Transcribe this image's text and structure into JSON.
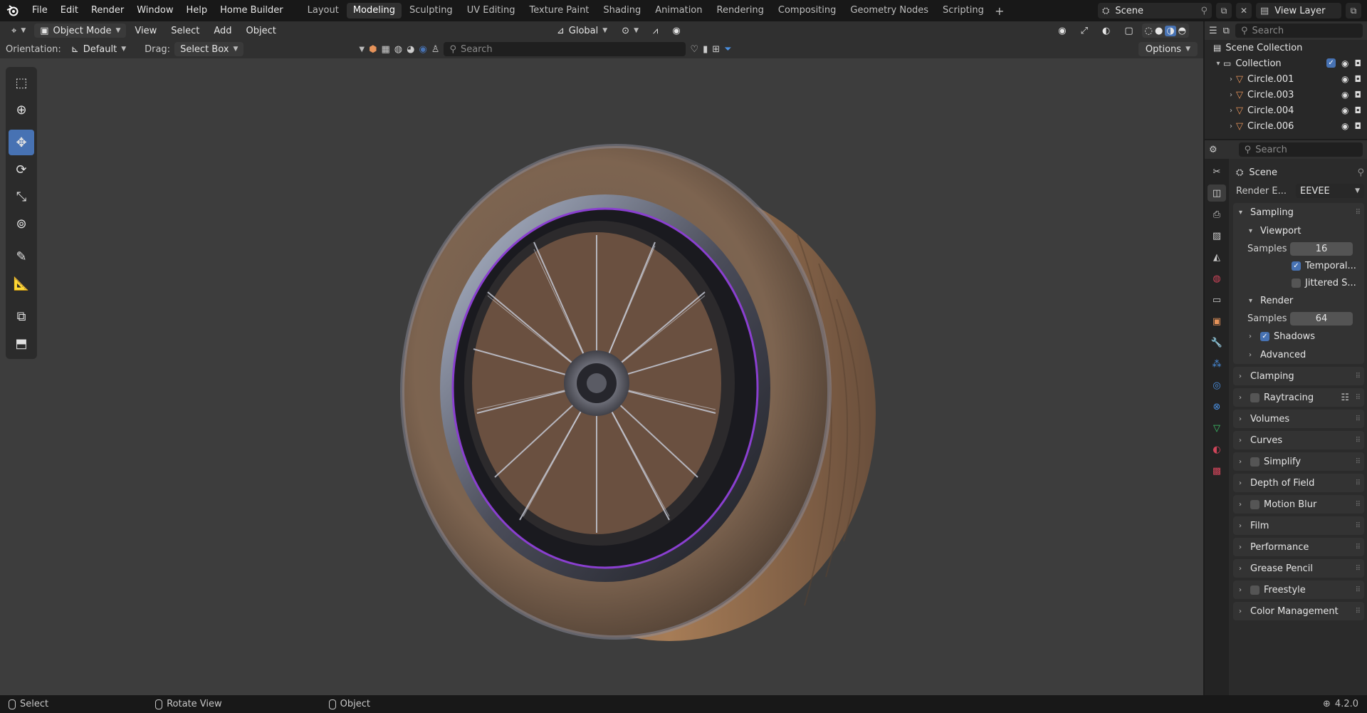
{
  "topbar": {
    "menus": [
      "File",
      "Edit",
      "Render",
      "Window",
      "Help",
      "Home Builder"
    ],
    "workspaces": [
      "Layout",
      "Modeling",
      "Sculpting",
      "UV Editing",
      "Texture Paint",
      "Shading",
      "Animation",
      "Rendering",
      "Compositing",
      "Geometry Nodes",
      "Scripting"
    ],
    "active_workspace": "Modeling",
    "scene": "Scene",
    "view_layer": "View Layer"
  },
  "viewport_header": {
    "mode": "Object Mode",
    "menus": [
      "View",
      "Select",
      "Add",
      "Object"
    ],
    "orientation_global": "Global"
  },
  "tool_settings": {
    "orientation_label": "Orientation:",
    "orientation_value": "Default",
    "drag_label": "Drag:",
    "drag_value": "Select Box",
    "search_placeholder": "Search",
    "options": "Options"
  },
  "outliner": {
    "search_placeholder": "Search",
    "scene_collection": "Scene Collection",
    "collection": "Collection",
    "objects": [
      "Circle.001",
      "Circle.003",
      "Circle.004",
      "Circle.006"
    ]
  },
  "properties": {
    "search_placeholder": "Search",
    "context": "Scene",
    "render_engine_label": "Render E...",
    "render_engine": "EEVEE",
    "sampling": {
      "title": "Sampling",
      "viewport": {
        "title": "Viewport",
        "samples_label": "Samples",
        "samples": "16",
        "temporal": "Temporal...",
        "jittered": "Jittered S..."
      },
      "render": {
        "title": "Render",
        "samples_label": "Samples",
        "samples": "64"
      },
      "shadows": "Shadows",
      "advanced": "Advanced"
    },
    "panels": [
      "Clamping",
      "Raytracing",
      "Volumes",
      "Curves",
      "Simplify",
      "Depth of Field",
      "Motion Blur",
      "Film",
      "Performance",
      "Grease Pencil",
      "Freestyle",
      "Color Management"
    ]
  },
  "statusbar": {
    "select": "Select",
    "rotate": "Rotate View",
    "object": "Object",
    "version": "4.2.0"
  },
  "colors": {
    "accent": "#4772b3",
    "viewport_bg": "#3d3d3d",
    "rim_glow": "#8a3fd0"
  }
}
